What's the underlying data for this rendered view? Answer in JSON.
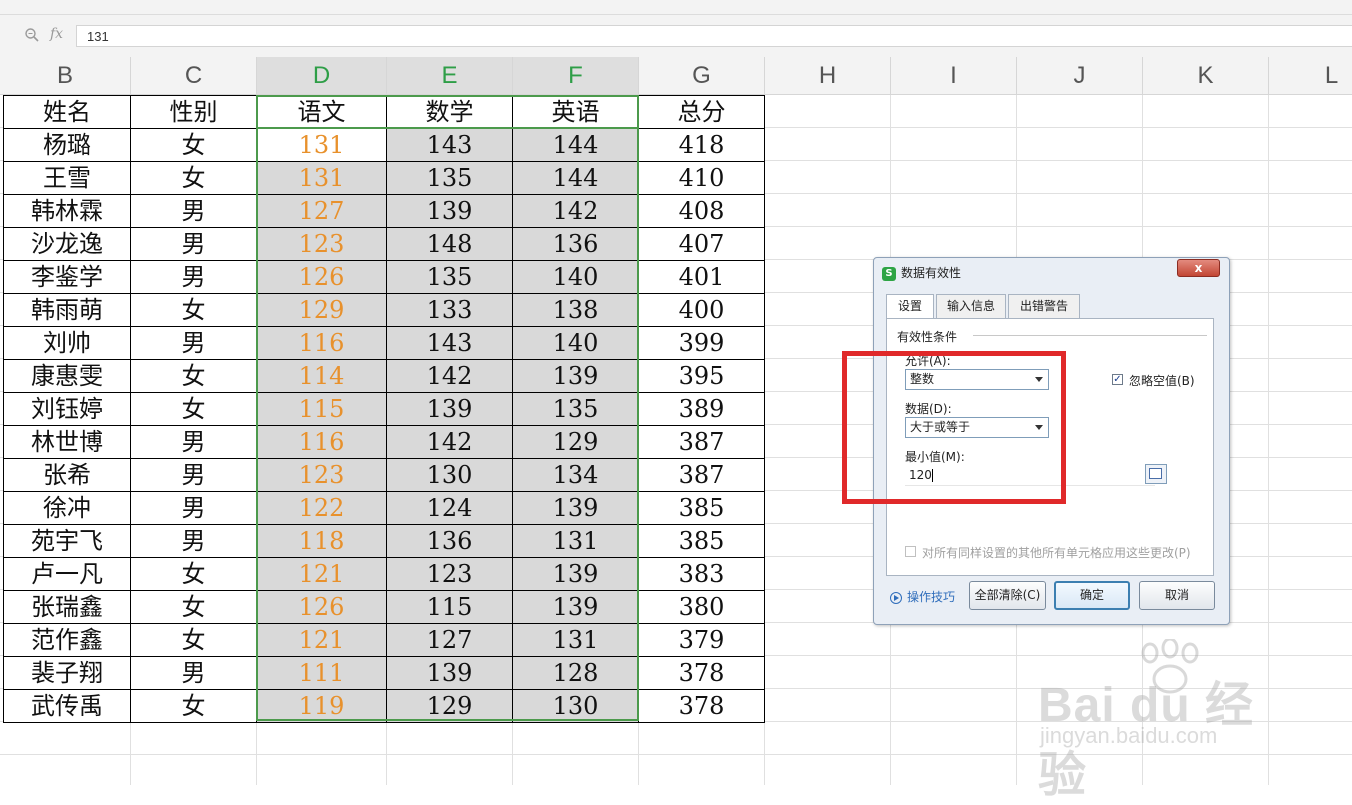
{
  "formula_bar": {
    "fx_label": "fx",
    "value": "131"
  },
  "columns": [
    "B",
    "C",
    "D",
    "E",
    "F",
    "G",
    "H",
    "I",
    "J",
    "K",
    "L"
  ],
  "table": {
    "headers": [
      "姓名",
      "性别",
      "语文",
      "数学",
      "英语",
      "总分"
    ],
    "rows": [
      [
        "杨璐",
        "女",
        "131",
        "143",
        "144",
        "418"
      ],
      [
        "王雪",
        "女",
        "131",
        "135",
        "144",
        "410"
      ],
      [
        "韩林霖",
        "男",
        "127",
        "139",
        "142",
        "408"
      ],
      [
        "沙龙逸",
        "男",
        "123",
        "148",
        "136",
        "407"
      ],
      [
        "李鉴学",
        "男",
        "126",
        "135",
        "140",
        "401"
      ],
      [
        "韩雨萌",
        "女",
        "129",
        "133",
        "138",
        "400"
      ],
      [
        "刘帅",
        "男",
        "116",
        "143",
        "140",
        "399"
      ],
      [
        "康惠雯",
        "女",
        "114",
        "142",
        "139",
        "395"
      ],
      [
        "刘钰婷",
        "女",
        "115",
        "139",
        "135",
        "389"
      ],
      [
        "林世博",
        "男",
        "116",
        "142",
        "129",
        "387"
      ],
      [
        "张希",
        "男",
        "123",
        "130",
        "134",
        "387"
      ],
      [
        "徐冲",
        "男",
        "122",
        "124",
        "139",
        "385"
      ],
      [
        "苑宇飞",
        "男",
        "118",
        "136",
        "131",
        "385"
      ],
      [
        "卢一凡",
        "女",
        "121",
        "123",
        "139",
        "383"
      ],
      [
        "张瑞鑫",
        "女",
        "126",
        "115",
        "139",
        "380"
      ],
      [
        "范作鑫",
        "女",
        "121",
        "127",
        "131",
        "379"
      ],
      [
        "裴子翔",
        "男",
        "111",
        "139",
        "128",
        "378"
      ],
      [
        "武传禹",
        "女",
        "119",
        "129",
        "130",
        "378"
      ]
    ]
  },
  "dialog": {
    "title": "数据有效性",
    "close": "x",
    "tabs": [
      "设置",
      "输入信息",
      "出错警告"
    ],
    "group_label": "有效性条件",
    "allow_label": "允许(A):",
    "allow_value": "整数",
    "ignore_blank_label": "忽略空值(B)",
    "ignore_blank_checked": "✓",
    "data_label": "数据(D):",
    "data_value": "大于或等于",
    "min_label": "最小值(M):",
    "min_value": "120",
    "apply_all_label": "对所有同样设置的其他所有单元格应用这些更改(P)",
    "tips_label": "操作技巧",
    "clear_all_button": "全部清除(C)",
    "ok_button": "确定",
    "cancel_button": "取消"
  },
  "watermark": {
    "brand": "Bai du 经验",
    "url": "jingyan.baidu.com"
  },
  "colors": {
    "selection_border": "#4c9a4c",
    "orange_text": "#e8912c",
    "highlight": "#e0292a"
  }
}
